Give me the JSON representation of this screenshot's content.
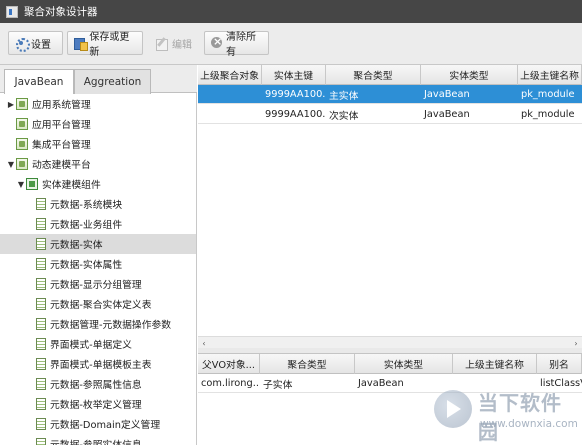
{
  "window": {
    "title": "聚合对象设计器"
  },
  "toolbar": {
    "settings_label": "设置",
    "save_update_label": "保存或更新",
    "edit_label": "编辑",
    "clear_all_label": "清除所有"
  },
  "tabs": [
    {
      "label": "JavaBean",
      "active": true
    },
    {
      "label": "Aggreation",
      "active": false
    }
  ],
  "tree": [
    {
      "label": "应用系统管理",
      "icon": "module-icon",
      "arrow": "▶"
    },
    {
      "label": "应用平台管理",
      "icon": "module-icon",
      "arrow": ""
    },
    {
      "label": "集成平台管理",
      "icon": "module-icon",
      "arrow": ""
    },
    {
      "label": "动态建模平台",
      "icon": "module-icon",
      "arrow": "▼"
    },
    {
      "label": "实体建模组件",
      "icon": "component-icon",
      "arrow": "▼"
    },
    {
      "label": "元数据-系统模块",
      "icon": "entity-icon",
      "arrow": ""
    },
    {
      "label": "元数据-业务组件",
      "icon": "entity-icon",
      "arrow": ""
    },
    {
      "label": "元数据-实体",
      "icon": "entity-icon",
      "arrow": "",
      "selected": true
    },
    {
      "label": "元数据-实体属性",
      "icon": "entity-icon",
      "arrow": ""
    },
    {
      "label": "元数据-显示分组管理",
      "icon": "entity-icon",
      "arrow": ""
    },
    {
      "label": "元数据-聚合实体定义表",
      "icon": "entity-icon",
      "arrow": ""
    },
    {
      "label": "元数据管理-元数据操作参数",
      "icon": "entity-icon",
      "arrow": ""
    },
    {
      "label": "界面模式-单据定义",
      "icon": "entity-icon",
      "arrow": ""
    },
    {
      "label": "界面模式-单据模板主表",
      "icon": "entity-icon",
      "arrow": ""
    },
    {
      "label": "元数据-参照属性信息",
      "icon": "entity-icon",
      "arrow": ""
    },
    {
      "label": "元数据-枚举定义管理",
      "icon": "entity-icon",
      "arrow": ""
    },
    {
      "label": "元数据-Domain定义管理",
      "icon": "entity-icon",
      "arrow": ""
    },
    {
      "label": "元数据-参照实体信息",
      "icon": "entity-icon",
      "arrow": ""
    }
  ],
  "upper_grid": {
    "columns": [
      "上级聚合对象",
      "实体主键",
      "聚合类型",
      "实体类型",
      "上级主键名称"
    ],
    "rows": [
      {
        "cells": [
          "",
          "9999AA100...",
          "主实体",
          "JavaBean",
          "pk_module"
        ],
        "selected": true
      },
      {
        "cells": [
          "",
          "9999AA100...",
          "次实体",
          "JavaBean",
          "pk_module"
        ],
        "selected": false
      }
    ]
  },
  "lower_grid": {
    "columns": [
      "父VO对象...",
      "聚合类型",
      "实体类型",
      "上级主键名称",
      "别名"
    ],
    "rows": [
      {
        "cells": [
          "com.lirong....",
          "子实体",
          "JavaBean",
          "",
          "listClassVO"
        ]
      }
    ]
  },
  "scrollbar": {
    "left_arrow": "‹",
    "right_arrow": "›"
  },
  "watermark": {
    "text": "当下软件园",
    "url": "www.downxia.com"
  }
}
